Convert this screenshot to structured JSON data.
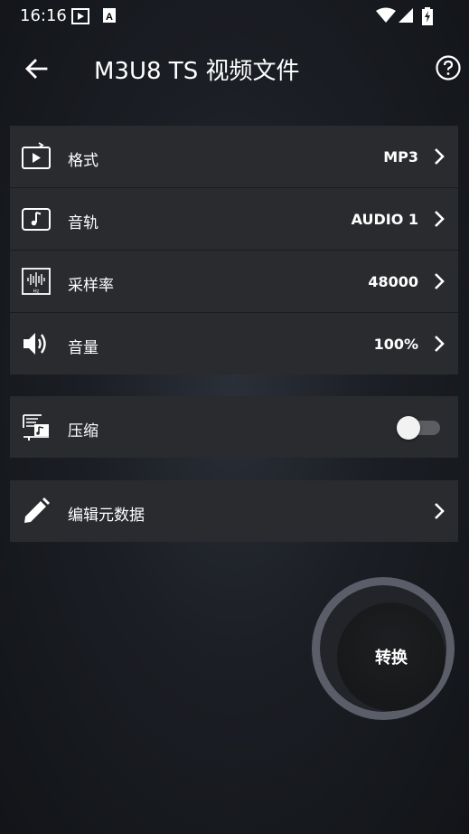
{
  "status_bar": {
    "time": "16:16",
    "icons": [
      "screen-record-icon",
      "a-badge-icon",
      "wifi-icon",
      "signal-icon",
      "battery-charging-icon"
    ]
  },
  "header": {
    "title": "M3U8 TS 视频文件",
    "back_icon": "arrow-left-icon",
    "help_icon": "help-circle-icon"
  },
  "settings": [
    {
      "icon": "format-icon",
      "label": "格式",
      "value": "MP3"
    },
    {
      "icon": "audio-track-icon",
      "label": "音轨",
      "value": "AUDIO 1"
    },
    {
      "icon": "sample-rate-icon",
      "label": "采样率",
      "value": "48000"
    },
    {
      "icon": "volume-icon",
      "label": "音量",
      "value": "100%"
    }
  ],
  "compress": {
    "icon": "compress-icon",
    "label": "压缩",
    "enabled": false
  },
  "metadata": {
    "icon": "pencil-icon",
    "label": "编辑元数据"
  },
  "convert_button": {
    "label": "转换"
  }
}
